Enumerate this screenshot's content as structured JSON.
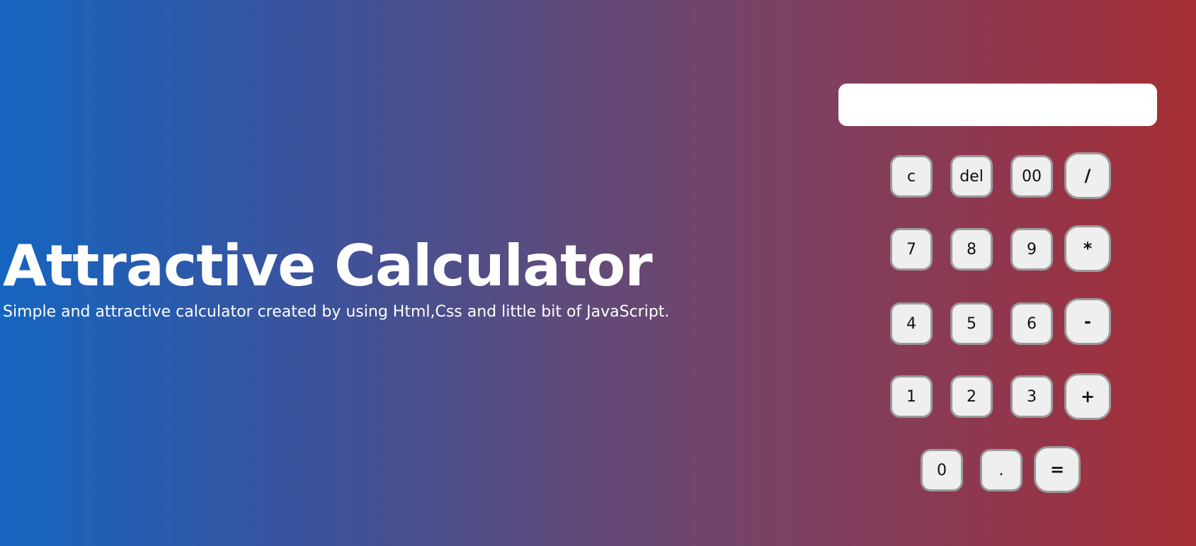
{
  "hero": {
    "title": "Attractive Calculator",
    "subtitle": "Simple and attractive calculator created by using Html,Css and little bit of JavaScript."
  },
  "display": {
    "value": ""
  },
  "keys": {
    "clear": "c",
    "delete": "del",
    "double_zero": "00",
    "divide": "/",
    "seven": "7",
    "eight": "8",
    "nine": "9",
    "multiply": "*",
    "four": "4",
    "five": "5",
    "six": "6",
    "subtract": "-",
    "one": "1",
    "two": "2",
    "three": "3",
    "add": "+",
    "zero": "0",
    "decimal": ".",
    "equals": "="
  },
  "colors": {
    "gradient_start": "#1565c0",
    "gradient_end": "#a62e33",
    "key_background": "#efefef",
    "key_border": "#9a9a9a",
    "display_background": "#ffffff"
  }
}
